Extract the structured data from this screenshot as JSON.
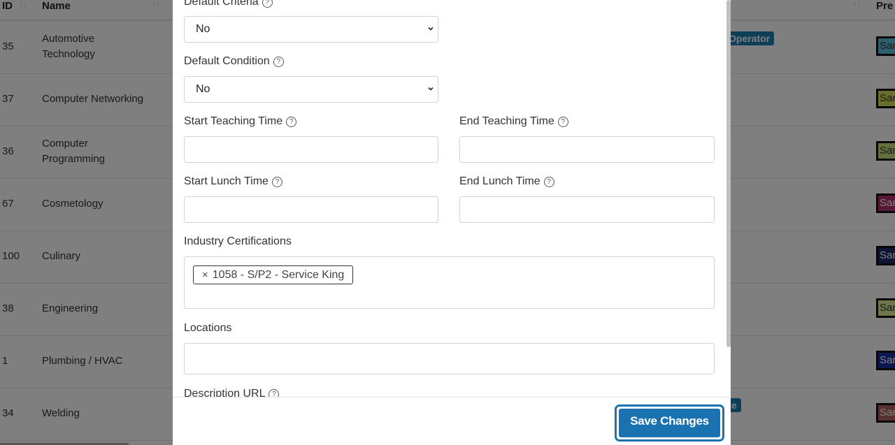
{
  "table": {
    "headers": {
      "id": "ID",
      "name": "Name",
      "preview": "Pre"
    },
    "rows": [
      {
        "id": "35",
        "name": "Automotive Technology",
        "preview_text": "Sam",
        "preview_bg": "#5bc0de",
        "preview_fg": "#333"
      },
      {
        "id": "37",
        "name": "Computer Networking",
        "preview_text": "Sam",
        "preview_bg": "#d4e157",
        "preview_fg": "#333"
      },
      {
        "id": "36",
        "name": "Computer Programming",
        "preview_text": "Sam",
        "preview_bg": "#c5e17a",
        "preview_fg": "#333"
      },
      {
        "id": "67",
        "name": "Cosmetology",
        "preview_text": "Sam",
        "preview_bg": "#b0306a",
        "preview_fg": "#fff"
      },
      {
        "id": "100",
        "name": "Culinary",
        "preview_text": "Sam",
        "preview_bg": "#1c2a6b",
        "preview_fg": "#fff"
      },
      {
        "id": "38",
        "name": "Engineering",
        "preview_text": "Sam",
        "preview_bg": "#d9ef94",
        "preview_fg": "#333"
      },
      {
        "id": "1",
        "name": "Plumbing / HVAC",
        "preview_text": "Sam",
        "preview_bg": "#1b2fa8",
        "preview_fg": "#fff"
      },
      {
        "id": "34",
        "name": "Welding",
        "preview_text": "Sam",
        "preview_bg": "#b06060",
        "preview_fg": "#fff"
      }
    ],
    "badges": {
      "row1": "Operator",
      "row8": "le"
    }
  },
  "modal": {
    "fields": {
      "default_criteria": {
        "label": "Default Criteria",
        "value": "No"
      },
      "default_condition": {
        "label": "Default Condition",
        "value": "No"
      },
      "start_teaching_time": {
        "label": "Start Teaching Time",
        "value": ""
      },
      "end_teaching_time": {
        "label": "End Teaching Time",
        "value": ""
      },
      "start_lunch_time": {
        "label": "Start Lunch Time",
        "value": ""
      },
      "end_lunch_time": {
        "label": "End Lunch Time",
        "value": ""
      },
      "industry_certifications": {
        "label": "Industry Certifications",
        "tags": [
          "1058 - S/P2 - Service King"
        ],
        "remove_glyph": "×"
      },
      "locations": {
        "label": "Locations",
        "value": ""
      },
      "description_url": {
        "label": "Description URL"
      }
    },
    "help_glyph": "?",
    "save_label": "Save Changes"
  },
  "colors": {
    "primary": "#1a73b0",
    "badge": "#1a7fb0",
    "backdrop": "rgba(0,0,0,0.5)"
  }
}
